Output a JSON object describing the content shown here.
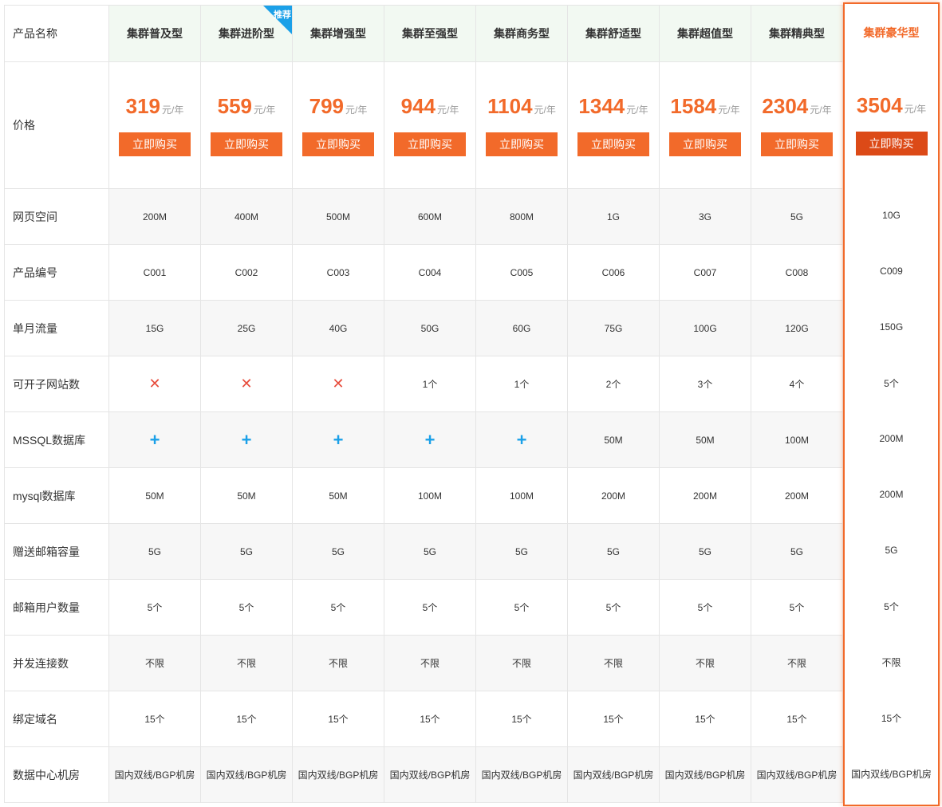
{
  "labels": {
    "product_name": "产品名称",
    "price": "价格",
    "web_space": "网页空间",
    "product_code": "产品编号",
    "monthly_traffic": "单月流量",
    "subsites": "可开子网站数",
    "mssql": "MSSQL数据库",
    "mysql": "mysql数据库",
    "mail_capacity": "赠送邮箱容量",
    "mail_users": "邮箱用户数量",
    "concurrency": "并发连接数",
    "domains": "绑定域名",
    "datacenter": "数据中心机房"
  },
  "recommend_badge": "推荐",
  "unit": "元/年",
  "buy_label": "立即购买",
  "colors": {
    "accent": "#f26a2a",
    "blue": "#1ba0e8",
    "cross": "#e74c3c"
  },
  "plans": [
    {
      "name": "集群普及型",
      "price": "319",
      "space": "200M",
      "code": "C001",
      "traffic": "15G",
      "subsites": "x",
      "mssql": "+",
      "mysql": "50M",
      "mail": "5G",
      "mailusers": "5个",
      "conc": "不限",
      "domains": "15个",
      "dc": "国内双线/BGP机房"
    },
    {
      "name": "集群进阶型",
      "price": "559",
      "space": "400M",
      "code": "C002",
      "traffic": "25G",
      "subsites": "x",
      "mssql": "+",
      "mysql": "50M",
      "mail": "5G",
      "mailusers": "5个",
      "conc": "不限",
      "domains": "15个",
      "dc": "国内双线/BGP机房"
    },
    {
      "name": "集群增强型",
      "price": "799",
      "space": "500M",
      "code": "C003",
      "traffic": "40G",
      "subsites": "x",
      "mssql": "+",
      "mysql": "50M",
      "mail": "5G",
      "mailusers": "5个",
      "conc": "不限",
      "domains": "15个",
      "dc": "国内双线/BGP机房"
    },
    {
      "name": "集群至强型",
      "price": "944",
      "space": "600M",
      "code": "C004",
      "traffic": "50G",
      "subsites": "1个",
      "mssql": "+",
      "mysql": "100M",
      "mail": "5G",
      "mailusers": "5个",
      "conc": "不限",
      "domains": "15个",
      "dc": "国内双线/BGP机房"
    },
    {
      "name": "集群商务型",
      "price": "1104",
      "space": "800M",
      "code": "C005",
      "traffic": "60G",
      "subsites": "1个",
      "mssql": "+",
      "mysql": "100M",
      "mail": "5G",
      "mailusers": "5个",
      "conc": "不限",
      "domains": "15个",
      "dc": "国内双线/BGP机房"
    },
    {
      "name": "集群舒适型",
      "price": "1344",
      "space": "1G",
      "code": "C006",
      "traffic": "75G",
      "subsites": "2个",
      "mssql": "50M",
      "mysql": "200M",
      "mail": "5G",
      "mailusers": "5个",
      "conc": "不限",
      "domains": "15个",
      "dc": "国内双线/BGP机房"
    },
    {
      "name": "集群超值型",
      "price": "1584",
      "space": "3G",
      "code": "C007",
      "traffic": "100G",
      "subsites": "3个",
      "mssql": "50M",
      "mysql": "200M",
      "mail": "5G",
      "mailusers": "5个",
      "conc": "不限",
      "domains": "15个",
      "dc": "国内双线/BGP机房"
    },
    {
      "name": "集群精典型",
      "price": "2304",
      "space": "5G",
      "code": "C008",
      "traffic": "120G",
      "subsites": "4个",
      "mssql": "100M",
      "mysql": "200M",
      "mail": "5G",
      "mailusers": "5个",
      "conc": "不限",
      "domains": "15个",
      "dc": "国内双线/BGP机房"
    }
  ],
  "featured": {
    "name": "集群豪华型",
    "price": "3504",
    "space": "10G",
    "code": "C009",
    "traffic": "150G",
    "subsites": "5个",
    "mssql": "200M",
    "mysql": "200M",
    "mail": "5G",
    "mailusers": "5个",
    "conc": "不限",
    "domains": "15个",
    "dc": "国内双线/BGP机房"
  }
}
